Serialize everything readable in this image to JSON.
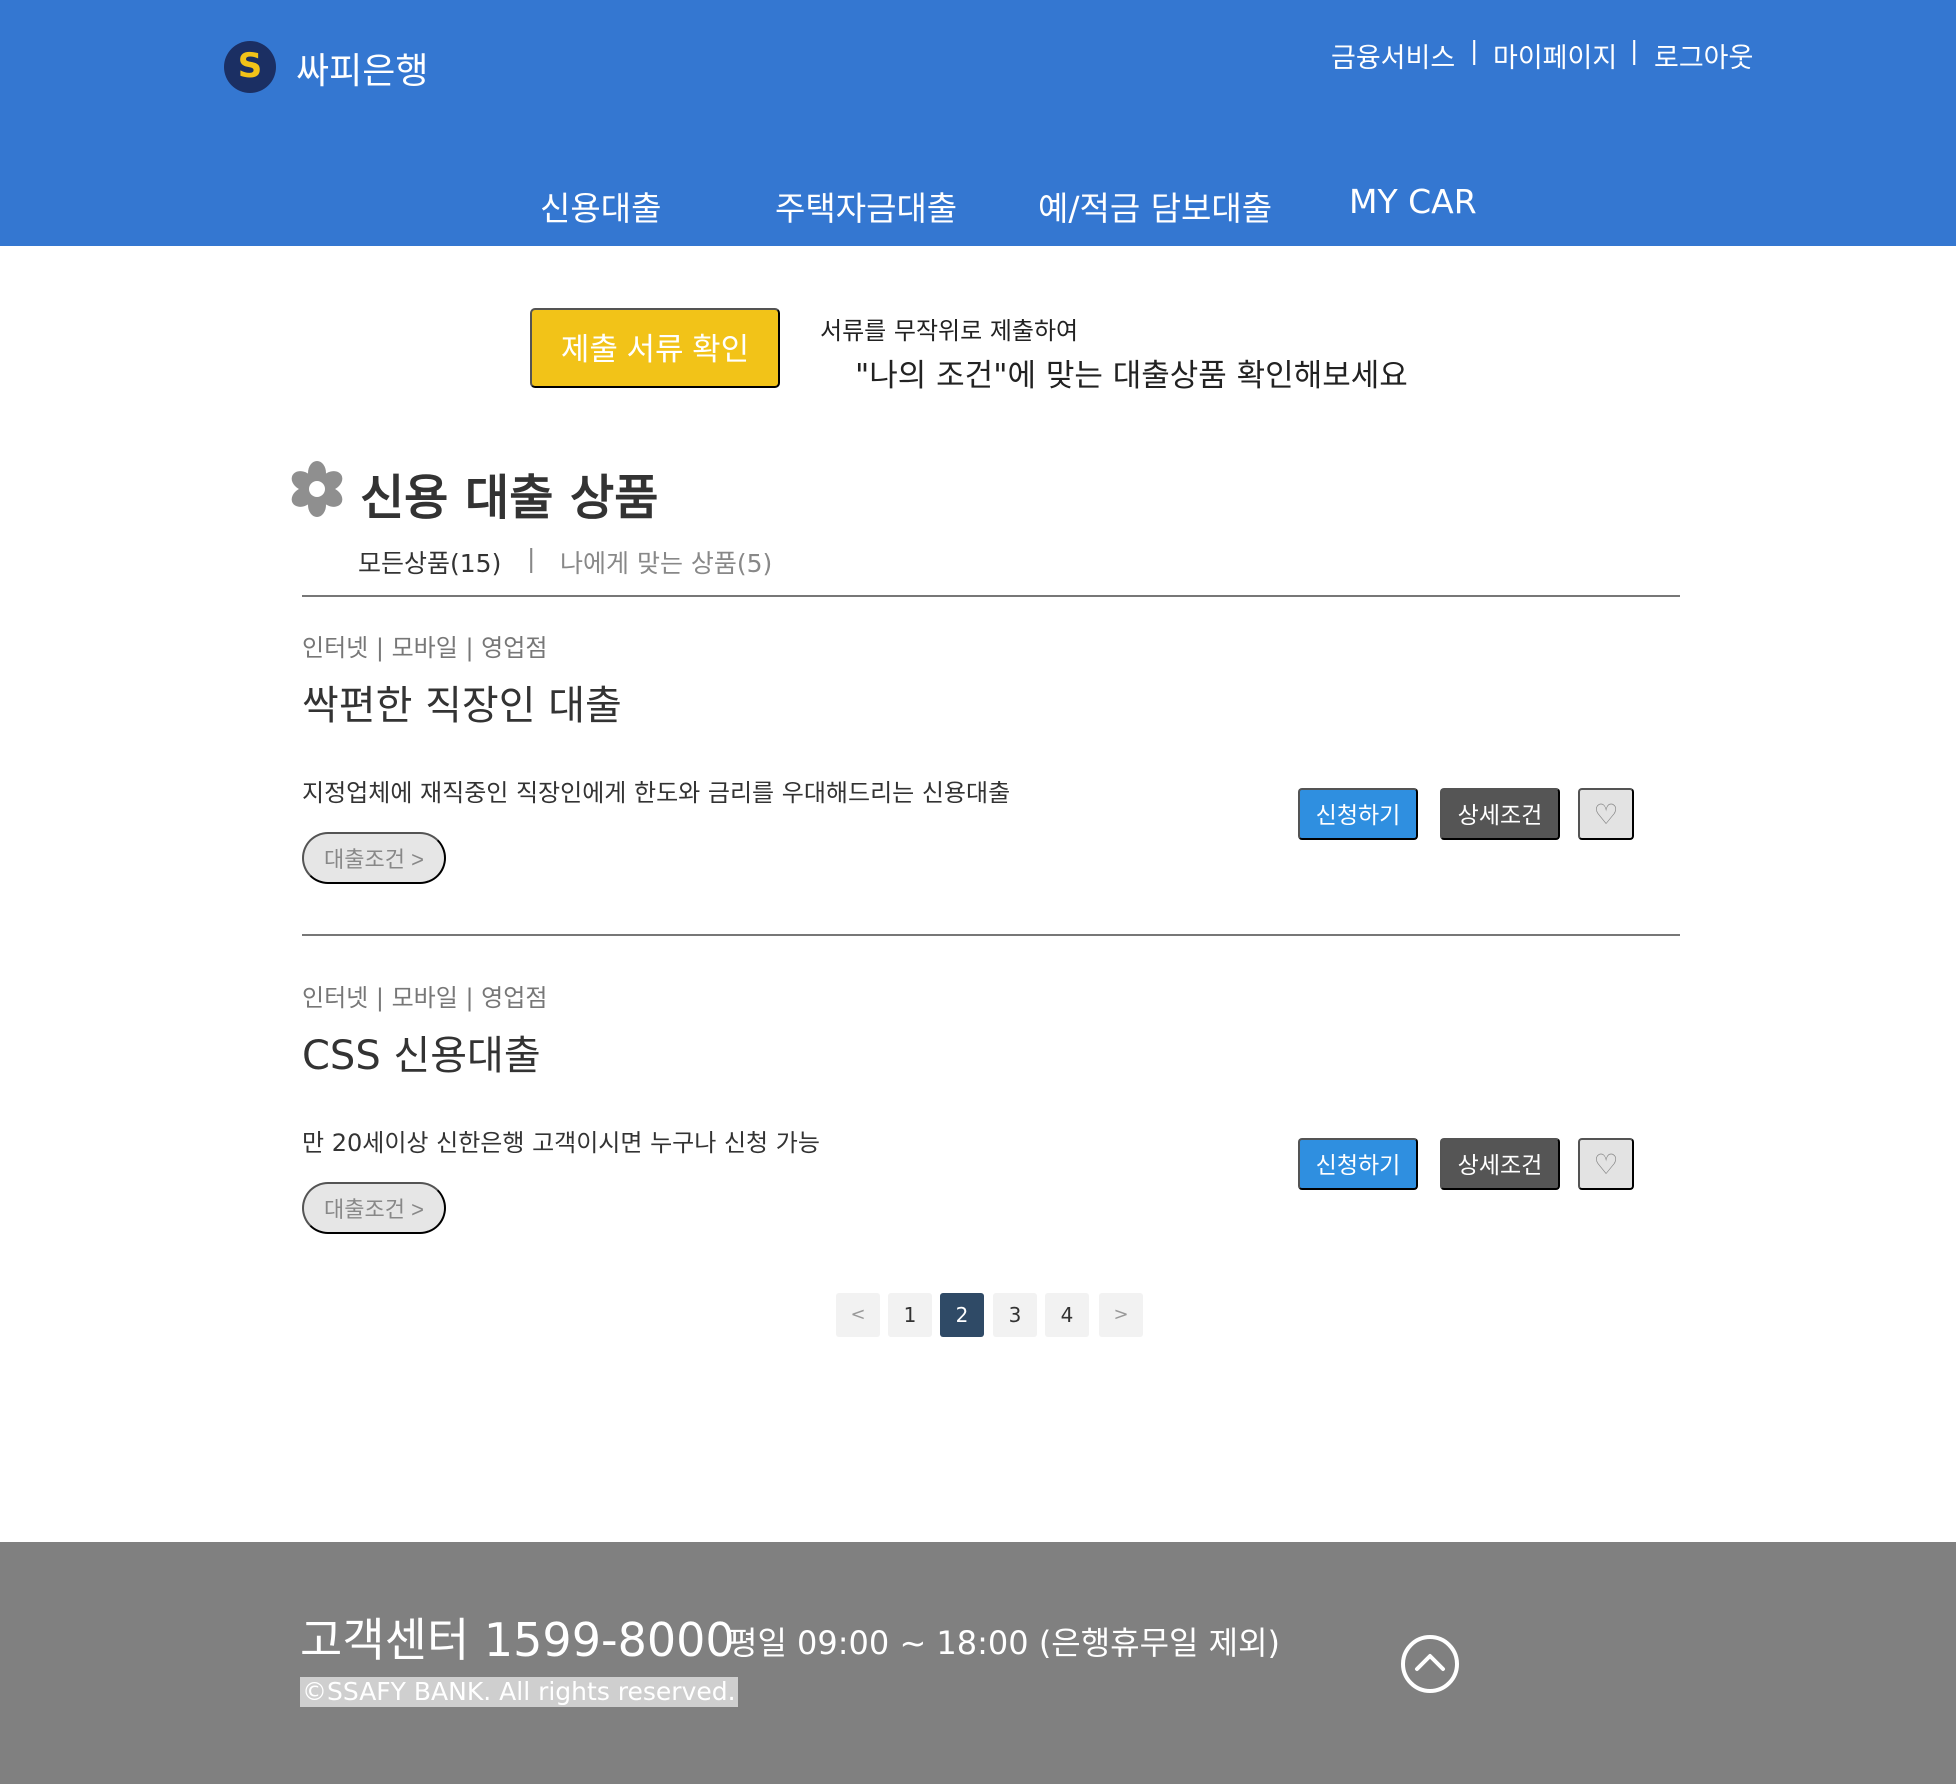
{
  "brand": {
    "logo_letter": "S",
    "name": "싸피은행"
  },
  "util_nav": {
    "items": [
      "금융서비스",
      "마이페이지",
      "로그아웃"
    ],
    "separator": "|"
  },
  "gnb": [
    "신용대출",
    "주택자금대출",
    "예/적금 담보대출",
    "MY CAR"
  ],
  "notice": {
    "button": "제출 서류 확인",
    "sub": "서류를 무작위로 제출하여",
    "main": "\"나의 조건\"에 맞는 대출상품 확인해보세요"
  },
  "section": {
    "title": "신용 대출 상품",
    "filter_all": "모든상품(15)",
    "filter_sep": "|",
    "filter_mine": "나에게 맞는 상품(5)"
  },
  "products": [
    {
      "channel": "인터넷 | 모바일 | 영업점",
      "name": "싹편한 직장인 대출",
      "desc": "지정업체에 재직중인 직장인에게 한도와 금리를 우대해드리는 신용대출",
      "cond": "대출조건 >",
      "apply": "신청하기",
      "detail": "상세조건",
      "like": "♡"
    },
    {
      "channel": "인터넷 | 모바일 | 영업점",
      "name": "CSS 신용대출",
      "desc": "만 20세이상 신한은행 고객이시면 누구나 신청 가능",
      "cond": "대출조건 >",
      "apply": "신청하기",
      "detail": "상세조건",
      "like": "♡"
    }
  ],
  "pagination": {
    "prev": "<",
    "pages": [
      "1",
      "2",
      "3",
      "4"
    ],
    "current": "2",
    "next": ">"
  },
  "footer": {
    "cs_title": "고객센터 1599-8000",
    "cs_hours": "평일 09:00 ~ 18:00 (은행휴무일 제외)",
    "copyright": "©SSAFY BANK. All rights reserved."
  },
  "colors": {
    "header": "#3477d1",
    "accent": "#f2c318",
    "apply": "#2f8fe0",
    "footer": "#808080",
    "page_active": "#2f4a66"
  },
  "icons": {
    "top": "chevron-up-circle-icon",
    "flower": "flower-icon",
    "like": "heart-icon"
  }
}
